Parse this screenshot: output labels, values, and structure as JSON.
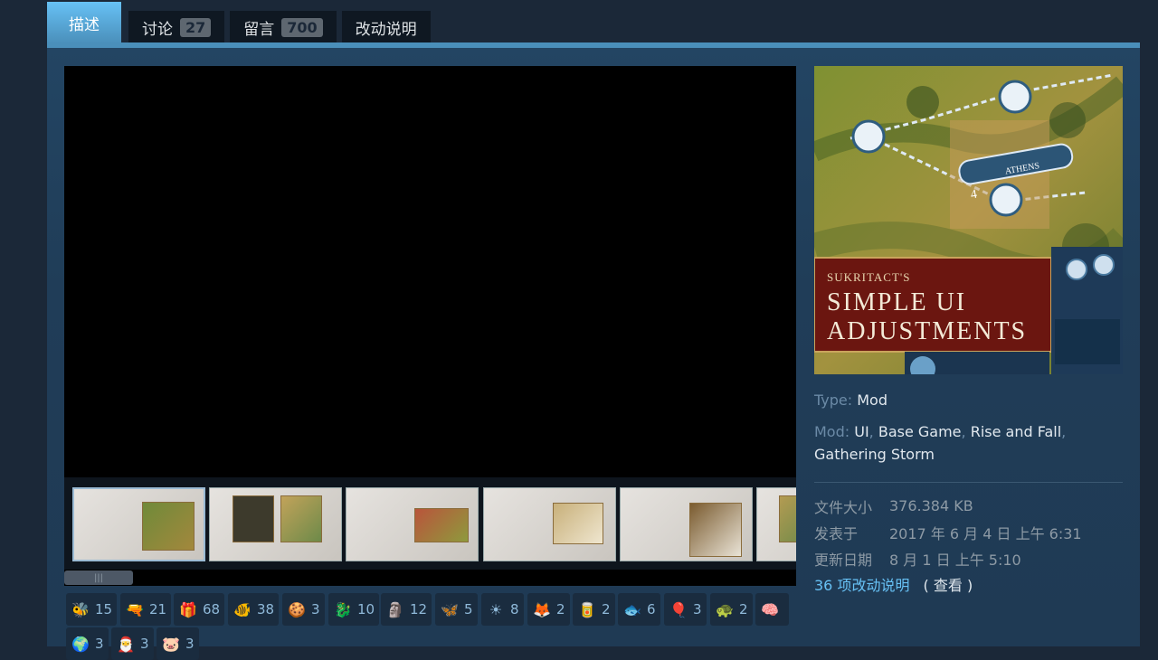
{
  "tabs": [
    {
      "label": "描述"
    },
    {
      "label": "讨论",
      "count": "27"
    },
    {
      "label": "留言",
      "count": "700"
    },
    {
      "label": "改动说明"
    }
  ],
  "hero": {
    "subtitle": "SUKRITACT'S",
    "title_line1": "SIMPLE UI",
    "title_line2": "ADJUSTMENTS",
    "city_name": "ATHENS",
    "city_pop": "4"
  },
  "info": {
    "type_label": "Type:",
    "type_value": "Mod",
    "mod_label": "Mod:",
    "mod_tags": [
      "UI",
      "Base Game",
      "Rise and Fall",
      "Gathering Storm"
    ]
  },
  "stats": {
    "size_label": "文件大小",
    "size_value": "376.384 KB",
    "posted_label": "发表于",
    "posted_value": "2017 年 6 月 4 日 上午 6:31",
    "updated_label": "更新日期",
    "updated_value": "8 月 1 日 上午 5:10"
  },
  "changes": {
    "link": "36 项改动说明",
    "view": "( 查看 )"
  },
  "scroll_knob": "|||",
  "awards": [
    {
      "icon": "🐝",
      "count": "15"
    },
    {
      "icon": "🔫",
      "count": "21"
    },
    {
      "icon": "🎁",
      "count": "68"
    },
    {
      "icon": "🐠",
      "count": "38"
    },
    {
      "icon": "🍪",
      "count": "3"
    },
    {
      "icon": "🐉",
      "count": "10"
    },
    {
      "icon": "🗿",
      "count": "12"
    },
    {
      "icon": "🦋",
      "count": "5"
    },
    {
      "icon": "☀",
      "count": "8"
    },
    {
      "icon": "🦊",
      "count": "2"
    },
    {
      "icon": "🥫",
      "count": "2"
    },
    {
      "icon": "🐟",
      "count": "6"
    },
    {
      "icon": "🎈",
      "count": "3"
    },
    {
      "icon": "🐢",
      "count": "2"
    },
    {
      "icon": "🧠",
      "count": ""
    },
    {
      "icon": "🌍",
      "count": "3"
    },
    {
      "icon": "🎅",
      "count": "3"
    },
    {
      "icon": "🐷",
      "count": "3"
    }
  ]
}
